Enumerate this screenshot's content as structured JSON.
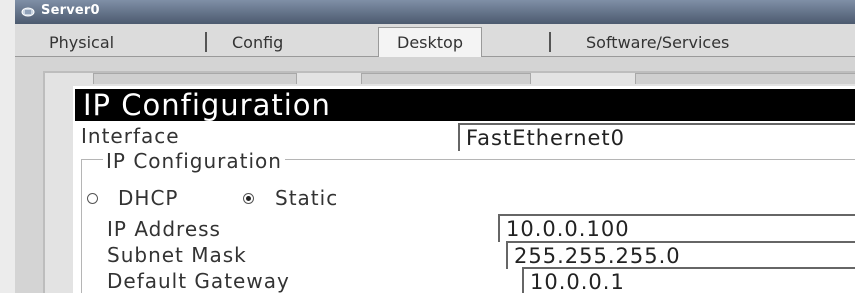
{
  "window": {
    "title": "Server0",
    "colors": {
      "titlebar": "#4c5a6f",
      "header": "#000000"
    }
  },
  "tabs": [
    {
      "label": "Physical",
      "active": false
    },
    {
      "label": "Config",
      "active": false
    },
    {
      "label": "Desktop",
      "active": true
    },
    {
      "label": "Software/Services",
      "active": false
    }
  ],
  "ip_config": {
    "header": "IP Configuration",
    "interface_label": "Interface",
    "interface_value": "FastEthernet0",
    "group_label": "IP Configuration",
    "dhcp_label": "DHCP",
    "static_label": "Static",
    "mode": "Static",
    "ip_address_label": "IP Address",
    "ip_address_value": "10.0.0.100",
    "subnet_mask_label": "Subnet Mask",
    "subnet_mask_value": "255.255.255.0",
    "gateway_label": "Default Gateway",
    "gateway_value": "10.0.0.1"
  }
}
